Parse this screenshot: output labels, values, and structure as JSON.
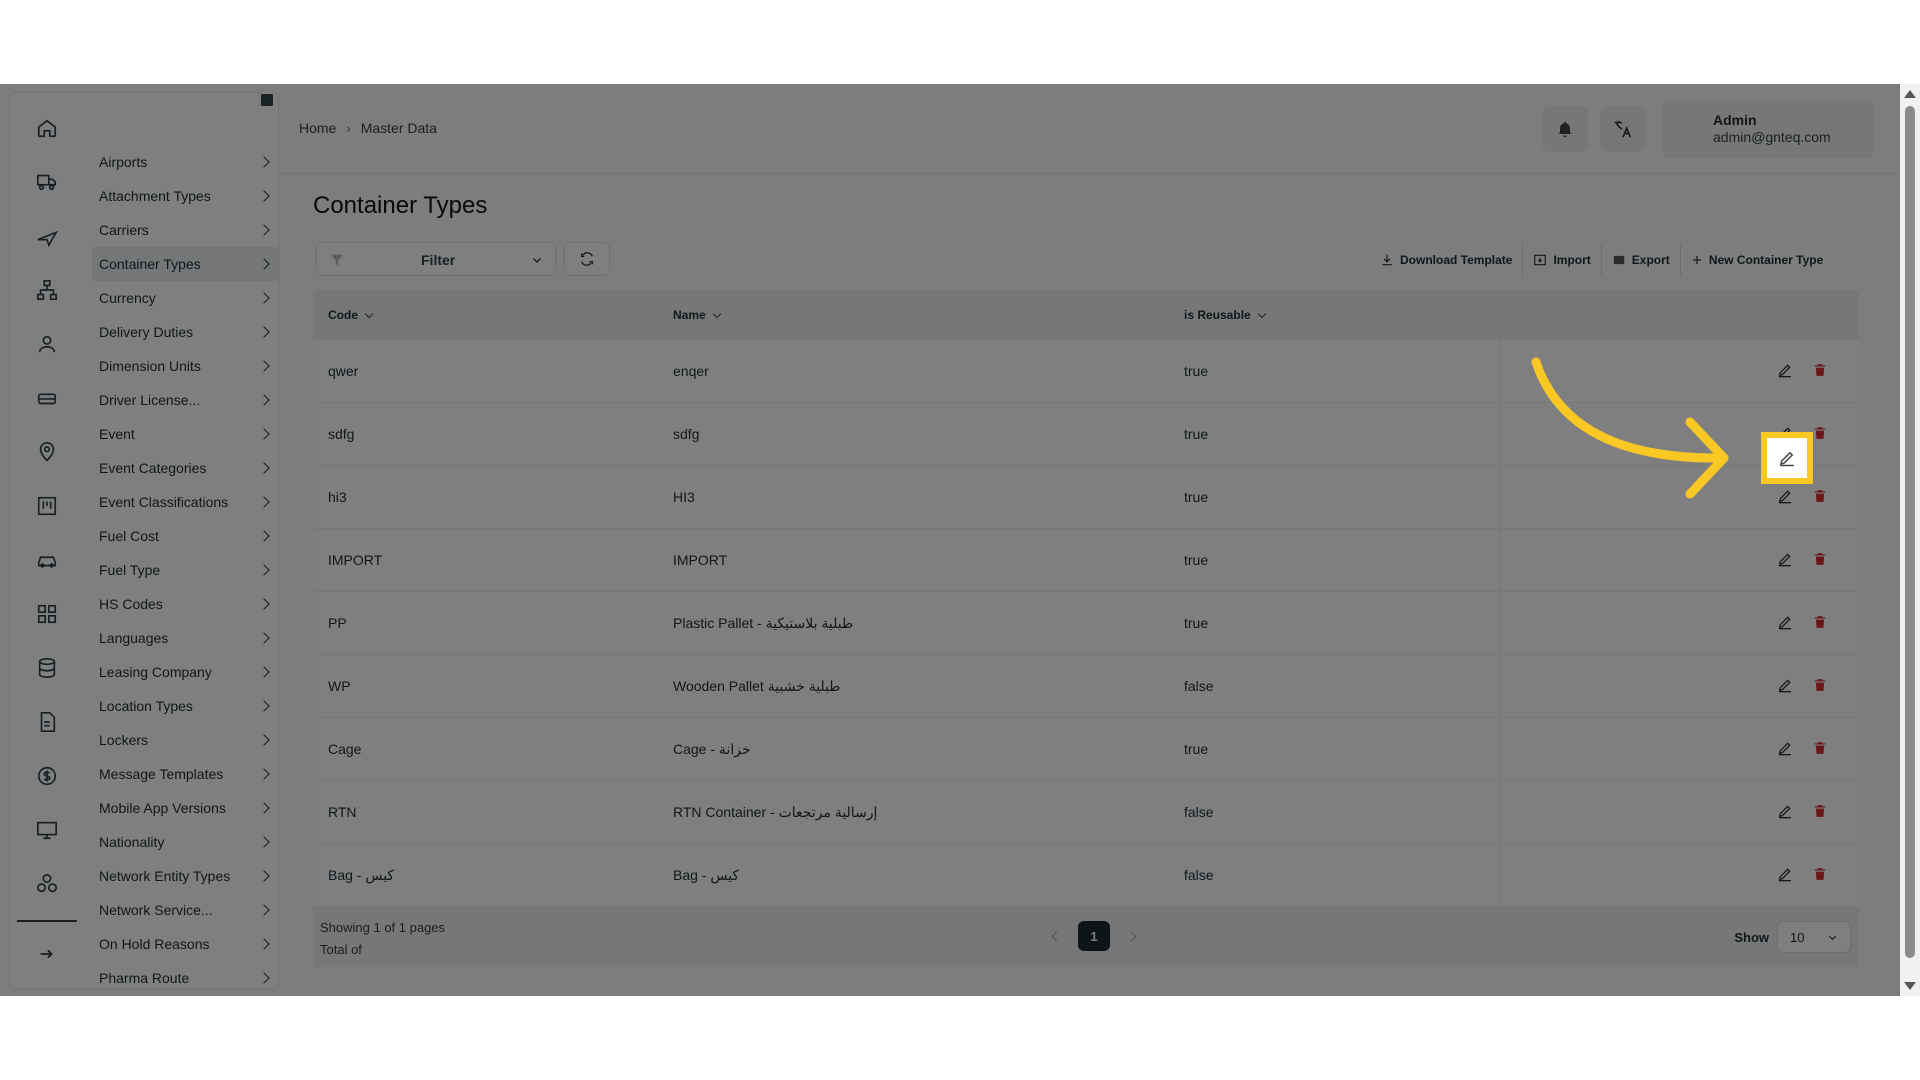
{
  "sidebar": {
    "rail_icons": [
      "home-icon",
      "truck-icon",
      "plane-icon",
      "hierarchy-icon",
      "user-icon",
      "vehicle-icon",
      "location-icon",
      "board-icon",
      "car-icon",
      "grid-icon",
      "database-icon",
      "document-icon",
      "dollar-icon",
      "monitor-icon",
      "network-icon",
      "logout-icon"
    ],
    "items": [
      {
        "label": "Airports"
      },
      {
        "label": "Attachment Types"
      },
      {
        "label": "Carriers"
      },
      {
        "label": "Container Types",
        "active": true
      },
      {
        "label": "Currency"
      },
      {
        "label": "Delivery Duties"
      },
      {
        "label": "Dimension Units"
      },
      {
        "label": "Driver License..."
      },
      {
        "label": "Event"
      },
      {
        "label": "Event Categories"
      },
      {
        "label": "Event Classifications"
      },
      {
        "label": "Fuel Cost"
      },
      {
        "label": "Fuel Type"
      },
      {
        "label": "HS Codes"
      },
      {
        "label": "Languages"
      },
      {
        "label": "Leasing Company"
      },
      {
        "label": "Location Types"
      },
      {
        "label": "Lockers"
      },
      {
        "label": "Message Templates"
      },
      {
        "label": "Mobile App Versions"
      },
      {
        "label": "Nationality"
      },
      {
        "label": "Network Entity Types"
      },
      {
        "label": "Network Service..."
      },
      {
        "label": "On Hold Reasons"
      },
      {
        "label": "Pharma Route"
      }
    ]
  },
  "header": {
    "breadcrumb": [
      "Home",
      "Master Data"
    ],
    "user": {
      "name": "Admin",
      "email": "admin@gnteq.com"
    }
  },
  "page": {
    "title": "Container Types",
    "filter_label": "Filter",
    "actions": {
      "download": "Download Template",
      "import": "Import",
      "export": "Export",
      "new": "New Container Type"
    }
  },
  "table": {
    "columns": [
      "Code",
      "Name",
      "is Reusable"
    ],
    "rows": [
      {
        "code": "qwer",
        "name": "enqer",
        "reusable": "true"
      },
      {
        "code": "sdfg",
        "name": "sdfg",
        "reusable": "true"
      },
      {
        "code": "hi3",
        "name": "HI3",
        "reusable": "true"
      },
      {
        "code": "IMPORT",
        "name": "IMPORT",
        "reusable": "true"
      },
      {
        "code": "PP",
        "name": "Plastic Pallet - طبلية بلاستيكية",
        "reusable": "true"
      },
      {
        "code": "WP",
        "name": "Wooden Pallet طبلية خشبية",
        "reusable": "false"
      },
      {
        "code": "Cage",
        "name": "Cage - خزانة",
        "reusable": "true"
      },
      {
        "code": "RTN",
        "name": "RTN Container - إرسالية مرتجعات",
        "reusable": "false"
      },
      {
        "code": "Bag - كيس",
        "name": "Bag - كيس",
        "reusable": "false"
      }
    ],
    "footer": {
      "showing": "Showing 1 of 1 pages",
      "total": "Total of",
      "current_page": "1",
      "show_label": "Show",
      "page_size": "10"
    }
  },
  "colors": {
    "highlight": "#f9c825",
    "delete": "#d32f2f",
    "active_page": "#1b2a30"
  }
}
